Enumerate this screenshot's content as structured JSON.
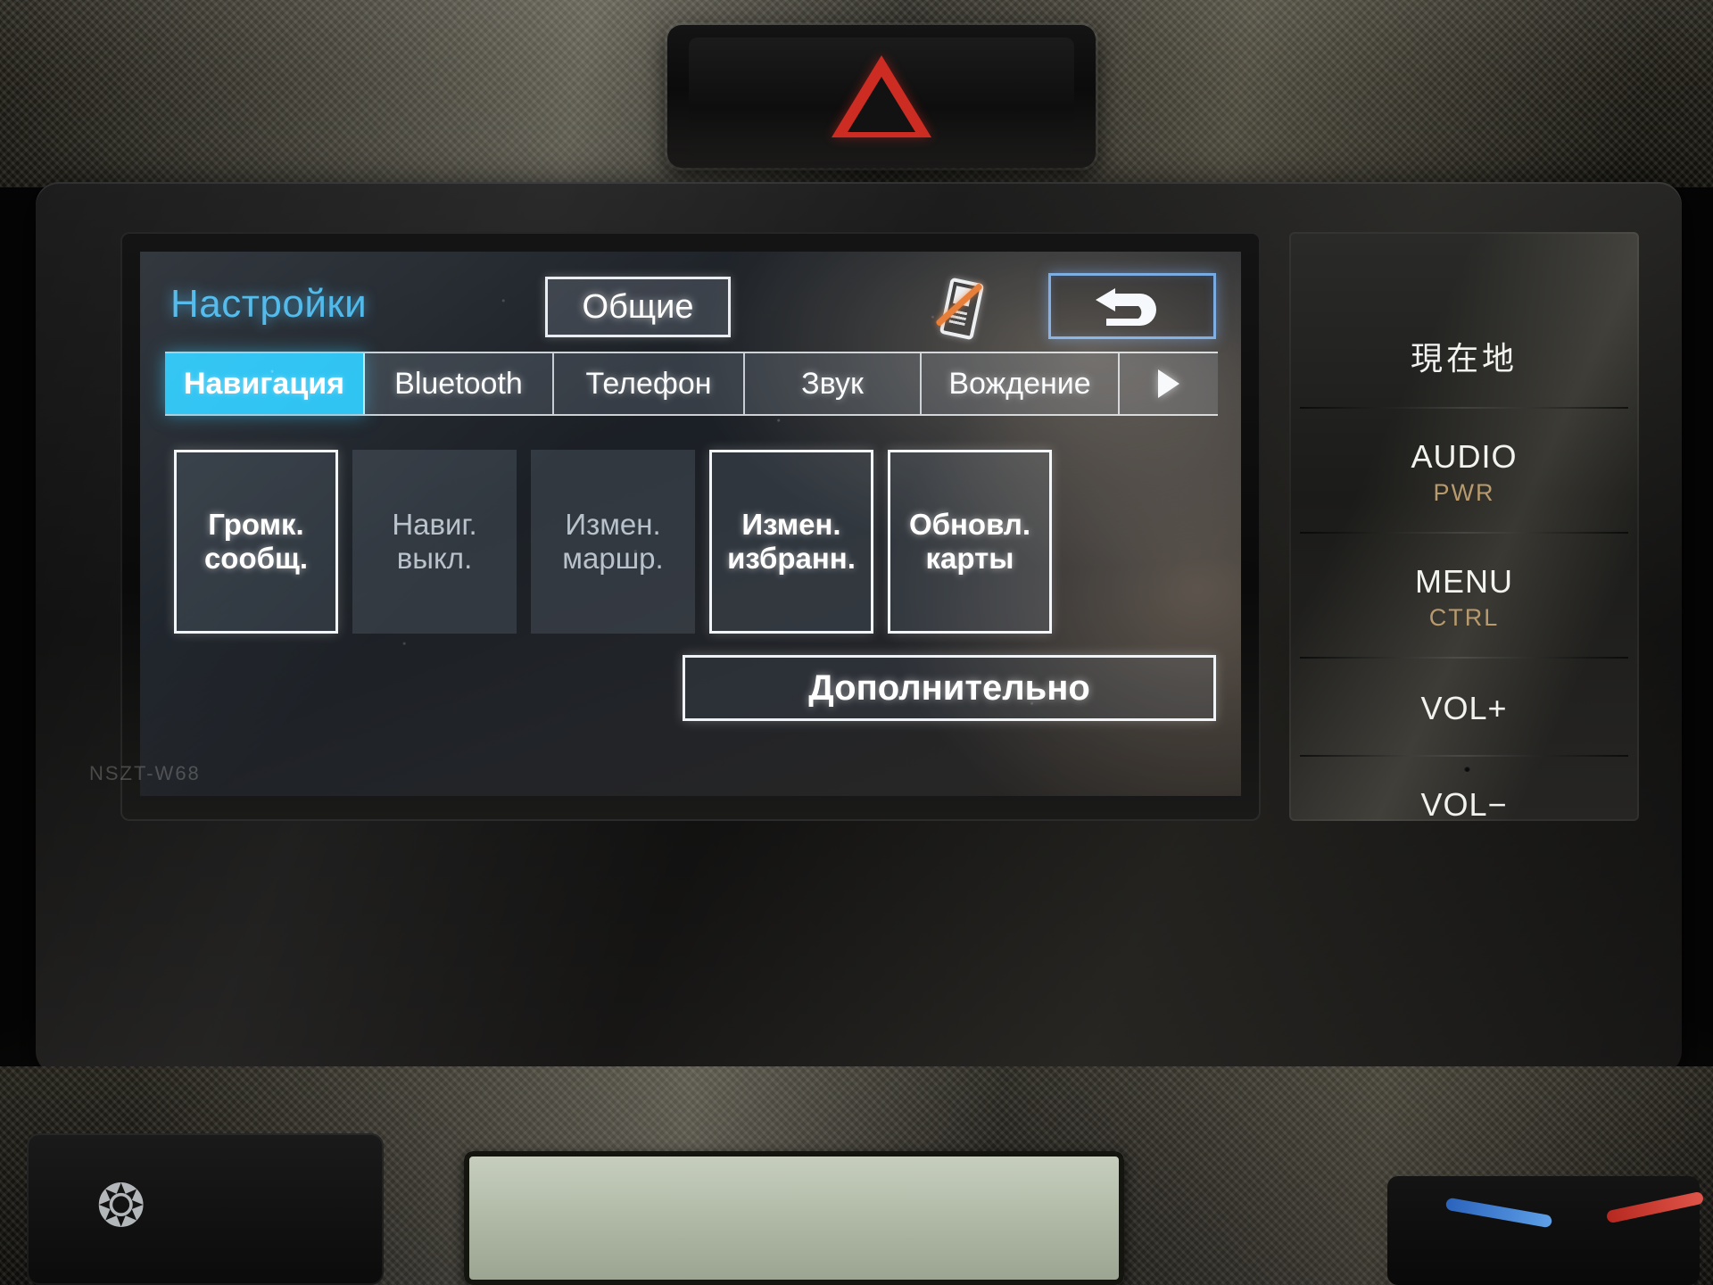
{
  "device": {
    "model_label": "NSZT-W68",
    "hazard_icon": "hazard-triangle-icon"
  },
  "screen": {
    "header": {
      "title": "Настройки",
      "general_button": "Общие",
      "phone_status_icon": "phone-disconnected-icon",
      "back_button_icon": "back-arrow-icon"
    },
    "tabs": [
      {
        "label": "Навигация",
        "active": true
      },
      {
        "label": "Bluetooth",
        "active": false
      },
      {
        "label": "Телефон",
        "active": false
      },
      {
        "label": "Звук",
        "active": false
      },
      {
        "label": "Вождение",
        "active": false
      },
      {
        "label": "",
        "active": false,
        "icon": "chevron-right-icon"
      }
    ],
    "buttons": [
      {
        "line1": "Громк.",
        "line2": "сообщ.",
        "enabled": true
      },
      {
        "line1": "Навиг.",
        "line2": "выкл.",
        "enabled": false
      },
      {
        "line1": "Измен.",
        "line2": "маршр.",
        "enabled": false
      },
      {
        "line1": "Измен.",
        "line2": "избранн.",
        "enabled": true
      },
      {
        "line1": "Обновл.",
        "line2": "карты",
        "enabled": true
      }
    ],
    "extra_button": "Дополнительно"
  },
  "hardware_keys": [
    {
      "main": "現在地",
      "sub": "",
      "is_jp": true
    },
    {
      "main": "AUDIO",
      "sub": "PWR",
      "is_jp": false
    },
    {
      "main": "MENU",
      "sub": "CTRL",
      "is_jp": false
    },
    {
      "main": "VOL+",
      "sub": "",
      "is_jp": false
    },
    {
      "main": "VOL−",
      "sub": "",
      "is_jp": false
    }
  ],
  "colors": {
    "accent_cyan": "#29c2f2",
    "title_blue": "#4ab7ea",
    "text_white": "#ffffff",
    "text_disabled": "#b9c2cb",
    "sub_label_gold": "#b79a6d",
    "phone_slash_orange": "#e2671e",
    "back_border_blue": "#5f9ddd"
  }
}
